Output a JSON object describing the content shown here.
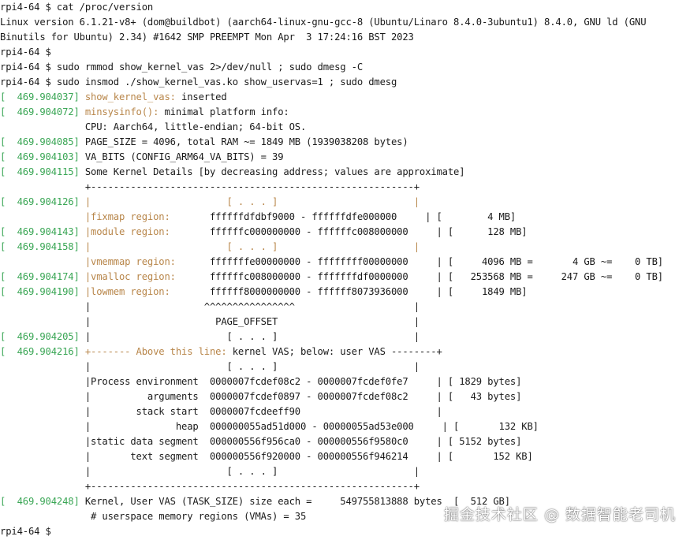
{
  "terminal": {
    "lines": [
      [
        {
          "t": "rpi4-64 $ cat /proc/version"
        }
      ],
      [
        {
          "t": "Linux version 6.1.21-v8+ (dom@buildbot) (aarch64-linux-gnu-gcc-8 (Ubuntu/Linaro 8.4.0-3ubuntu1) 8.4.0, GNU ld (GNU"
        }
      ],
      [
        {
          "t": "Binutils for Ubuntu) 2.34) #1642 SMP PREEMPT Mon Apr  3 17:24:16 BST 2023"
        }
      ],
      [
        {
          "t": "rpi4-64 $"
        }
      ],
      [
        {
          "t": "rpi4-64 $ sudo rmmod show_kernel_vas 2>/dev/null ; sudo dmesg -C"
        }
      ],
      [
        {
          "t": "rpi4-64 $ sudo insmod ./show_kernel_vas.ko show_uservas=1 ; sudo dmesg"
        }
      ],
      [
        {
          "t": "[  469.904037] ",
          "c": "ts"
        },
        {
          "t": "show_kernel_vas:",
          "c": "fn"
        },
        {
          "t": " inserted"
        }
      ],
      [
        {
          "t": "[  469.904072] ",
          "c": "ts"
        },
        {
          "t": "minsysinfo():",
          "c": "fn"
        },
        {
          "t": " minimal platform info:"
        }
      ],
      [
        {
          "t": "               CPU: Aarch64, little-endian; 64-bit OS."
        }
      ],
      [
        {
          "t": "[  469.904085] ",
          "c": "ts"
        },
        {
          "t": "PAGE_SIZE = 4096, total RAM ~= 1849 MB (1939038208 bytes)"
        }
      ],
      [
        {
          "t": "[  469.904103] ",
          "c": "ts"
        },
        {
          "t": "VA_BITS (CONFIG_ARM64_VA_BITS) = 39"
        }
      ],
      [
        {
          "t": "[  469.904115] ",
          "c": "ts"
        },
        {
          "t": "Some Kernel Details [by decreasing address; values are approximate]"
        }
      ],
      [
        {
          "t": "               +---------------------------------------------------------+"
        }
      ],
      [
        {
          "t": "[  469.904126] ",
          "c": "ts"
        },
        {
          "t": "|                        [ . . . ]                        |",
          "c": "reg"
        }
      ],
      [
        {
          "t": "               "
        },
        {
          "t": "|fixmap region:",
          "c": "reg"
        },
        {
          "t": "       ffffffdfdbf9000 - ffffffdfe000000     | [        4 MB]"
        }
      ],
      [
        {
          "t": "[  469.904143] ",
          "c": "ts"
        },
        {
          "t": "|module region:",
          "c": "reg"
        },
        {
          "t": "       ffffffc000000000 - ffffffc008000000     | [      128 MB]"
        }
      ],
      [
        {
          "t": "[  469.904158] ",
          "c": "ts"
        },
        {
          "t": "|                        [ . . . ]                        |",
          "c": "reg"
        }
      ],
      [
        {
          "t": "               "
        },
        {
          "t": "|vmemmap region:",
          "c": "reg"
        },
        {
          "t": "      fffffffe00000000 - ffffffff00000000     | [     4096 MB =       4 GB ~=    0 TB]"
        }
      ],
      [
        {
          "t": "[  469.904174] ",
          "c": "ts"
        },
        {
          "t": "|vmalloc region:",
          "c": "reg"
        },
        {
          "t": "      ffffffc008000000 - fffffffdf0000000     | [   253568 MB =     247 GB ~=    0 TB]"
        }
      ],
      [
        {
          "t": "[  469.904190] ",
          "c": "ts"
        },
        {
          "t": "|lowmem region:",
          "c": "reg"
        },
        {
          "t": "       ffffff8000000000 - ffffff8073936000     | [     1849 MB]"
        }
      ],
      [
        {
          "t": "               |                    ^^^^^^^^^^^^^^^^                     |"
        }
      ],
      [
        {
          "t": "               |                      PAGE_OFFSET                        |"
        }
      ],
      [
        {
          "t": "[  469.904205] ",
          "c": "ts"
        },
        {
          "t": "|                        [ . . . ]                        |"
        }
      ],
      [
        {
          "t": "[  469.904216] ",
          "c": "ts"
        },
        {
          "t": "+------- Above this line:",
          "c": "reg"
        },
        {
          "t": " kernel VAS; below: user VAS --------+"
        }
      ],
      [
        {
          "t": "               |                        [ . . . ]                        |"
        }
      ],
      [
        {
          "t": "               |Process environment  0000007fcdef08c2 - 0000007fcdef0fe7     | [ 1829 bytes]"
        }
      ],
      [
        {
          "t": "               |          arguments  0000007fcdef0897 - 0000007fcdef08c2     | [   43 bytes]"
        }
      ],
      [
        {
          "t": "               |        stack start  0000007fcdeeff90                        |"
        }
      ],
      [
        {
          "t": "               |               heap  000000055ad51d000 - 00000055ad53e000     | [       132 KB]"
        }
      ],
      [
        {
          "t": "               |static data segment  000000556f956ca0 - 000000556f9580c0     | [ 5152 bytes]"
        }
      ],
      [
        {
          "t": "               |       text segment  000000556f920000 - 000000556f946214     | [       152 KB]"
        }
      ],
      [
        {
          "t": "               |                        [ . . . ]                        |"
        }
      ],
      [
        {
          "t": "               +---------------------------------------------------------+"
        }
      ],
      [
        {
          "t": "[  469.904248] ",
          "c": "ts"
        },
        {
          "t": "Kernel, User VAS (TASK_SIZE) size each =     549755813888 bytes  [  512 GB]"
        }
      ],
      [
        {
          "t": "                # userspace memory regions (VMAs) = 35"
        }
      ],
      [
        {
          "t": "rpi4-64 $"
        }
      ]
    ]
  },
  "watermark": "掘金技术社区 @ 数据智能老司机"
}
